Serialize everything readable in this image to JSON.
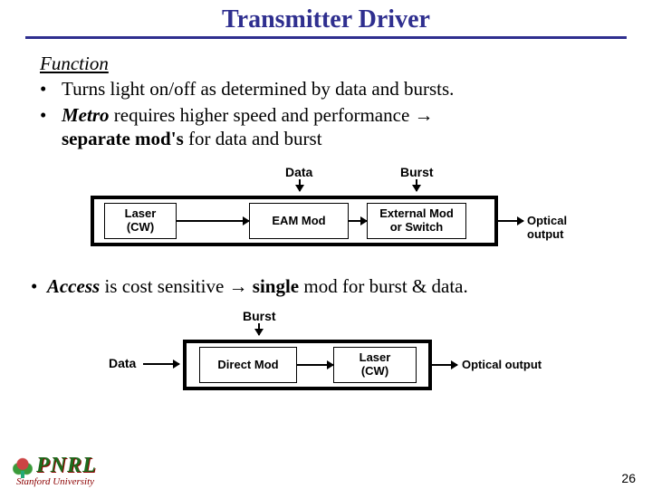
{
  "title": "Transmitter Driver",
  "function_heading": "Function",
  "bullets_top": [
    {
      "text": "Turns light on/off as determined by data and bursts."
    },
    {
      "lead_italic": "Metro",
      "rest1": " requires higher speed and performance ",
      "arrow": "→",
      "rest2": " separate mod's",
      "rest3": " for data and burst"
    }
  ],
  "diagram1": {
    "data_label": "Data",
    "burst_label": "Burst",
    "laser_box": "Laser\n(CW)",
    "eam_box": "EAM Mod",
    "ext_box": "External Mod\nor Switch",
    "output_label": "Optical output"
  },
  "access_line": {
    "lead_italic": "Access",
    "rest1": " is cost sensitive ",
    "arrow": "→",
    "rest2": " single",
    "rest3": " mod for burst & data."
  },
  "diagram2": {
    "data_label": "Data",
    "burst_label": "Burst",
    "mod_box": "Direct Mod",
    "laser_box": "Laser\n(CW)",
    "output_label": "Optical output"
  },
  "footer": {
    "logo_text": "PNRL",
    "university": "Stanford University"
  },
  "page_number": "26"
}
